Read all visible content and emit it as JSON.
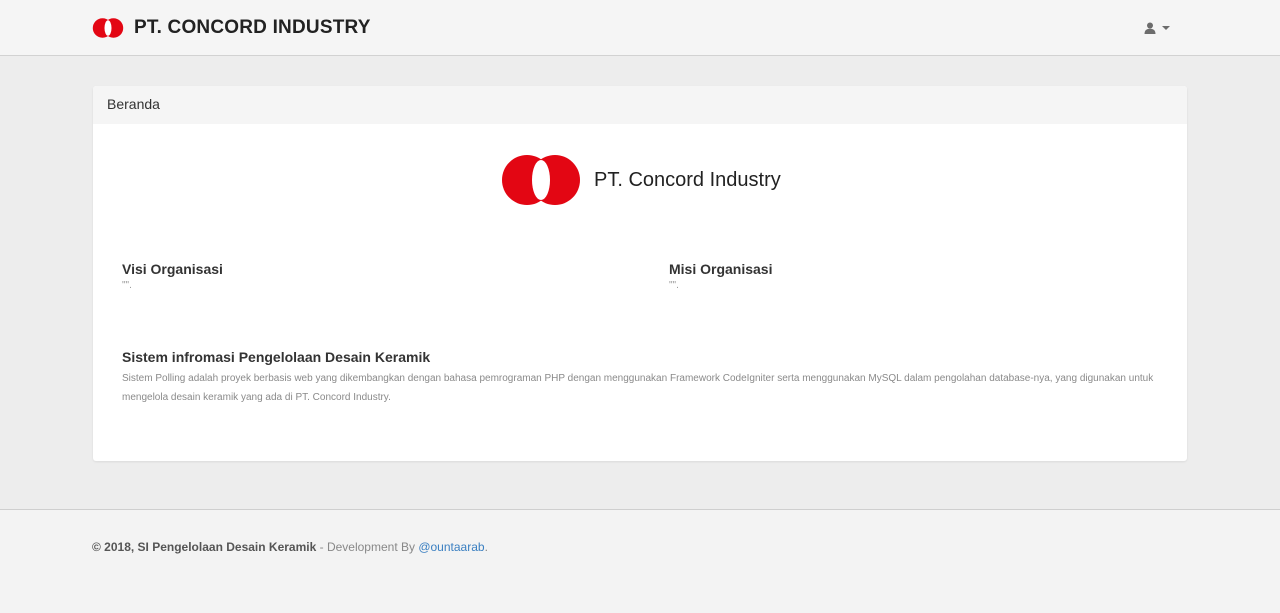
{
  "navbar": {
    "brand_text": "PT. CONCORD INDUSTRY",
    "logo_icon": "concord-logo-icon",
    "user_icon": "user-icon",
    "caret_icon": "caret-down-icon"
  },
  "panel": {
    "heading": "Beranda",
    "hero_title": "PT. Concord Industry",
    "visi": {
      "title": "Visi Organisasi",
      "value": "\"\"."
    },
    "misi": {
      "title": "Misi Organisasi",
      "value": "\"\"."
    },
    "about": {
      "title": "Sistem infromasi Pengelolaan Desain Keramik",
      "description": "Sistem Polling adalah proyek berbasis web yang dikembangkan dengan bahasa pemrograman PHP dengan menggunakan Framework CodeIgniter serta menggunakan MySQL dalam pengolahan database-nya, yang digunakan untuk mengelola desain keramik yang ada di PT. Concord Industry."
    }
  },
  "footer": {
    "copyright": "© 2018, SI Pengelolaan Desain Keramik",
    "separator": " - Development By ",
    "link_text": "@ountaarab",
    "trailing": "."
  },
  "colors": {
    "brand_red": "#e30613",
    "link_blue": "#3a7fc1",
    "page_bg": "#ededed"
  }
}
